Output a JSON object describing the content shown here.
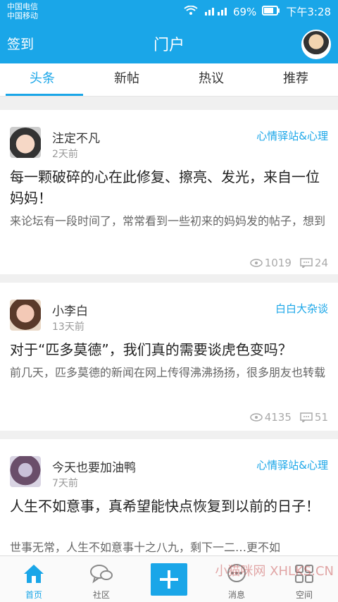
{
  "status": {
    "carrier1": "中国电信",
    "carrier2": "中国移动",
    "battery": "69%",
    "time": "下午3:28"
  },
  "appbar": {
    "left": "签到",
    "title": "门户"
  },
  "tabs": [
    {
      "label": "头条"
    },
    {
      "label": "新帖"
    },
    {
      "label": "热议"
    },
    {
      "label": "推荐"
    }
  ],
  "feed": [
    {
      "user": "注定不凡",
      "time": "2天前",
      "forum": "心情驿站&心理",
      "title": "每一颗破碎的心在此修复、擦亮、发光，来自一位妈妈！",
      "desc": "来论坛有一段时间了，常常看到一些初来的妈妈发的帖子，想到",
      "views": "1019",
      "comments": "24"
    },
    {
      "user": "小李白",
      "time": "13天前",
      "forum": "白白大杂谈",
      "title": "对于“匹多莫德”，我们真的需要谈虎色变吗？",
      "desc": "前几天，匹多莫德的新闻在网上传得沸沸扬扬，很多朋友也转载",
      "views": "4135",
      "comments": "51"
    },
    {
      "user": "今天也要加油鸭",
      "time": "7天前",
      "forum": "心情驿站&心理",
      "title": "人生不如意事，真希望能快点恢复到以前的日子！",
      "desc": "世事无常，人生不如意事十之八九，剩下一二…更不如",
      "views": "",
      "comments": ""
    }
  ],
  "bottom": [
    {
      "label": "首页"
    },
    {
      "label": "社区"
    },
    {
      "label": ""
    },
    {
      "label": "消息"
    },
    {
      "label": "空间"
    }
  ],
  "watermark": "小猫咪网 XHLKS.CN"
}
